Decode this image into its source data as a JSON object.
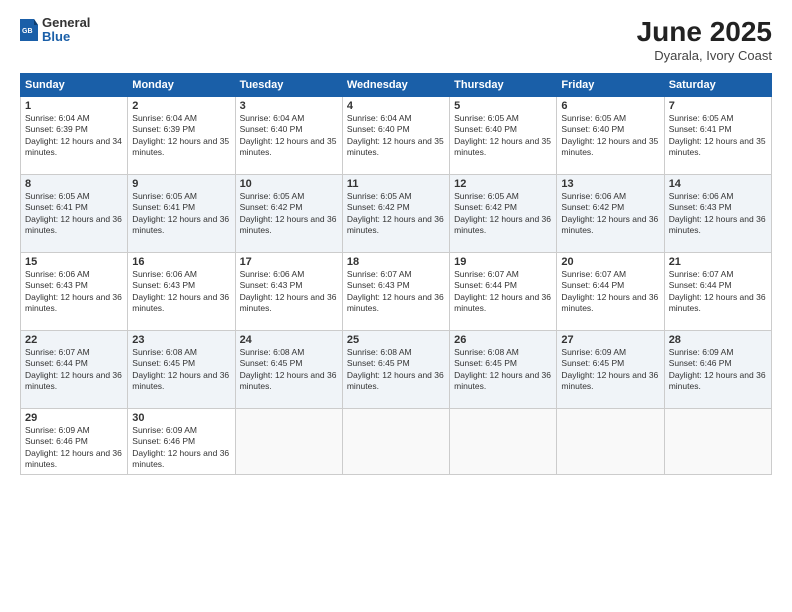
{
  "logo": {
    "general": "General",
    "blue": "Blue"
  },
  "header": {
    "month": "June 2025",
    "location": "Dyarala, Ivory Coast"
  },
  "days_of_week": [
    "Sunday",
    "Monday",
    "Tuesday",
    "Wednesday",
    "Thursday",
    "Friday",
    "Saturday"
  ],
  "weeks": [
    [
      {
        "day": 1,
        "sunrise": "6:04 AM",
        "sunset": "6:39 PM",
        "daylight": "12 hours and 34 minutes."
      },
      {
        "day": 2,
        "sunrise": "6:04 AM",
        "sunset": "6:39 PM",
        "daylight": "12 hours and 35 minutes."
      },
      {
        "day": 3,
        "sunrise": "6:04 AM",
        "sunset": "6:40 PM",
        "daylight": "12 hours and 35 minutes."
      },
      {
        "day": 4,
        "sunrise": "6:04 AM",
        "sunset": "6:40 PM",
        "daylight": "12 hours and 35 minutes."
      },
      {
        "day": 5,
        "sunrise": "6:05 AM",
        "sunset": "6:40 PM",
        "daylight": "12 hours and 35 minutes."
      },
      {
        "day": 6,
        "sunrise": "6:05 AM",
        "sunset": "6:40 PM",
        "daylight": "12 hours and 35 minutes."
      },
      {
        "day": 7,
        "sunrise": "6:05 AM",
        "sunset": "6:41 PM",
        "daylight": "12 hours and 35 minutes."
      }
    ],
    [
      {
        "day": 8,
        "sunrise": "6:05 AM",
        "sunset": "6:41 PM",
        "daylight": "12 hours and 36 minutes."
      },
      {
        "day": 9,
        "sunrise": "6:05 AM",
        "sunset": "6:41 PM",
        "daylight": "12 hours and 36 minutes."
      },
      {
        "day": 10,
        "sunrise": "6:05 AM",
        "sunset": "6:42 PM",
        "daylight": "12 hours and 36 minutes."
      },
      {
        "day": 11,
        "sunrise": "6:05 AM",
        "sunset": "6:42 PM",
        "daylight": "12 hours and 36 minutes."
      },
      {
        "day": 12,
        "sunrise": "6:05 AM",
        "sunset": "6:42 PM",
        "daylight": "12 hours and 36 minutes."
      },
      {
        "day": 13,
        "sunrise": "6:06 AM",
        "sunset": "6:42 PM",
        "daylight": "12 hours and 36 minutes."
      },
      {
        "day": 14,
        "sunrise": "6:06 AM",
        "sunset": "6:43 PM",
        "daylight": "12 hours and 36 minutes."
      }
    ],
    [
      {
        "day": 15,
        "sunrise": "6:06 AM",
        "sunset": "6:43 PM",
        "daylight": "12 hours and 36 minutes."
      },
      {
        "day": 16,
        "sunrise": "6:06 AM",
        "sunset": "6:43 PM",
        "daylight": "12 hours and 36 minutes."
      },
      {
        "day": 17,
        "sunrise": "6:06 AM",
        "sunset": "6:43 PM",
        "daylight": "12 hours and 36 minutes."
      },
      {
        "day": 18,
        "sunrise": "6:07 AM",
        "sunset": "6:43 PM",
        "daylight": "12 hours and 36 minutes."
      },
      {
        "day": 19,
        "sunrise": "6:07 AM",
        "sunset": "6:44 PM",
        "daylight": "12 hours and 36 minutes."
      },
      {
        "day": 20,
        "sunrise": "6:07 AM",
        "sunset": "6:44 PM",
        "daylight": "12 hours and 36 minutes."
      },
      {
        "day": 21,
        "sunrise": "6:07 AM",
        "sunset": "6:44 PM",
        "daylight": "12 hours and 36 minutes."
      }
    ],
    [
      {
        "day": 22,
        "sunrise": "6:07 AM",
        "sunset": "6:44 PM",
        "daylight": "12 hours and 36 minutes."
      },
      {
        "day": 23,
        "sunrise": "6:08 AM",
        "sunset": "6:45 PM",
        "daylight": "12 hours and 36 minutes."
      },
      {
        "day": 24,
        "sunrise": "6:08 AM",
        "sunset": "6:45 PM",
        "daylight": "12 hours and 36 minutes."
      },
      {
        "day": 25,
        "sunrise": "6:08 AM",
        "sunset": "6:45 PM",
        "daylight": "12 hours and 36 minutes."
      },
      {
        "day": 26,
        "sunrise": "6:08 AM",
        "sunset": "6:45 PM",
        "daylight": "12 hours and 36 minutes."
      },
      {
        "day": 27,
        "sunrise": "6:09 AM",
        "sunset": "6:45 PM",
        "daylight": "12 hours and 36 minutes."
      },
      {
        "day": 28,
        "sunrise": "6:09 AM",
        "sunset": "6:46 PM",
        "daylight": "12 hours and 36 minutes."
      }
    ],
    [
      {
        "day": 29,
        "sunrise": "6:09 AM",
        "sunset": "6:46 PM",
        "daylight": "12 hours and 36 minutes."
      },
      {
        "day": 30,
        "sunrise": "6:09 AM",
        "sunset": "6:46 PM",
        "daylight": "12 hours and 36 minutes."
      },
      null,
      null,
      null,
      null,
      null
    ]
  ]
}
